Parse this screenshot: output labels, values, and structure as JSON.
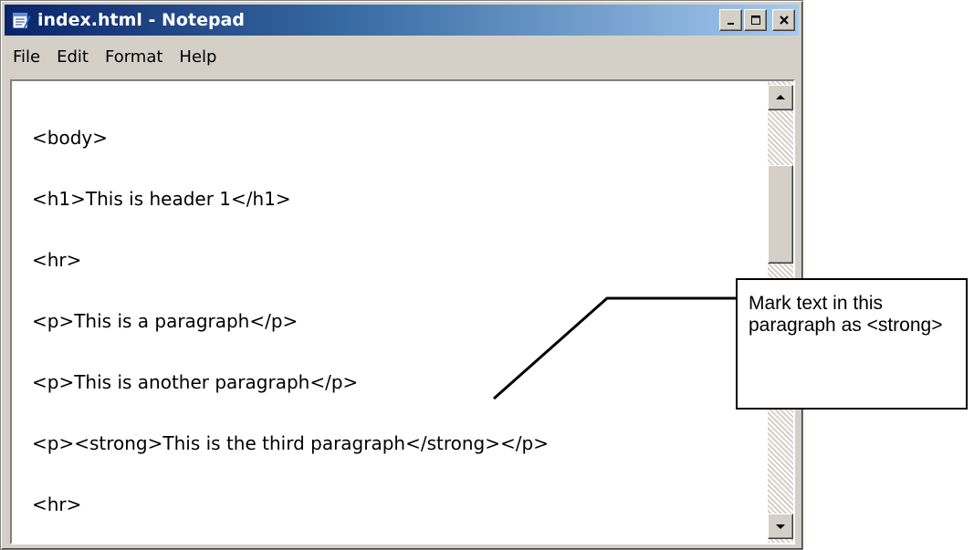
{
  "window": {
    "title": "index.html - Notepad",
    "controls": {
      "minimize_icon": "minimize-icon",
      "maximize_icon": "maximize-icon",
      "close_icon": "close-icon"
    },
    "colors": {
      "title_gradient_start": "#0a246a",
      "title_gradient_end": "#a6caf0",
      "chrome": "#d4d0c8"
    }
  },
  "menu": [
    "File",
    "Edit",
    "Format",
    "Help"
  ],
  "editor": {
    "lines": [
      "<body>",
      "<h1>This is header 1</h1>",
      "<hr>",
      "<p>This is a paragraph</p>",
      "<p>This is another paragraph</p>",
      "<p><strong>This is the third paragraph</strong></p>",
      "<hr>"
    ]
  },
  "callout": {
    "text": "Mark text in this paragraph as <strong>"
  }
}
